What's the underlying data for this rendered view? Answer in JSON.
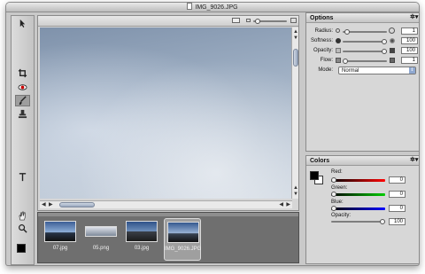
{
  "window": {
    "title": "IMG_9026.JPG"
  },
  "tools": [
    {
      "name": "arrow-tool-icon"
    },
    {
      "name": "crop-tool-icon"
    },
    {
      "name": "red-eye-tool-icon"
    },
    {
      "name": "brush-tool-icon"
    },
    {
      "name": "stamp-tool-icon"
    },
    {
      "name": "text-tool-icon"
    },
    {
      "name": "hand-tool-icon"
    },
    {
      "name": "zoom-tool-icon"
    }
  ],
  "active_tool": "brush-tool-icon",
  "colors_swatch": {
    "foreground": "#000000",
    "background": "#ffffff"
  },
  "filmstrip": {
    "items": [
      {
        "label": "07.jpg"
      },
      {
        "label": "05.png"
      },
      {
        "label": "03.jpg"
      },
      {
        "label": "IMG_9026.JPG",
        "selected": true
      }
    ]
  },
  "options": {
    "title": "Options",
    "radius": {
      "label": "Radius:",
      "value": "1"
    },
    "softness": {
      "label": "Softness:",
      "value": "100"
    },
    "opacity": {
      "label": "Opacity:",
      "value": "100"
    },
    "flow": {
      "label": "Flow:",
      "value": "1"
    },
    "mode": {
      "label": "Mode:",
      "value": "Normal"
    }
  },
  "colors": {
    "title": "Colors",
    "red": {
      "label": "Red:",
      "value": "0"
    },
    "green": {
      "label": "Green:",
      "value": "0"
    },
    "blue": {
      "label": "Blue:",
      "value": "0"
    },
    "opacity": {
      "label": "Opacity:",
      "value": "100"
    }
  }
}
